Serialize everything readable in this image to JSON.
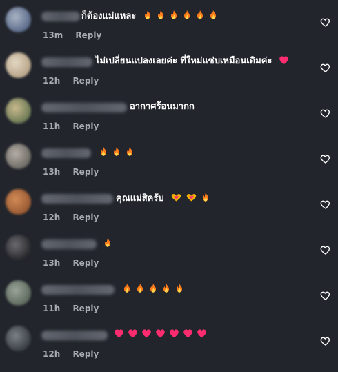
{
  "comments": [
    {
      "text": "ก็ต้องแม่แหละ",
      "emojis": [
        "flame",
        "flame",
        "flame",
        "flame",
        "flame",
        "flame"
      ],
      "time": "13m",
      "reply": "Reply",
      "avatar_colors": [
        "#5b6b8a",
        "#a9b3c4"
      ]
    },
    {
      "text": "ไม่เปลี่ยนแปลงเลยค่ะ ที่ใหม่แซ่บเหมือนเดิมค่ะ",
      "emojis": [
        "heart"
      ],
      "time": "12h",
      "reply": "Reply",
      "avatar_colors": [
        "#b8a58a",
        "#e3d7c2"
      ]
    },
    {
      "text": "อากาศร้อนมากก",
      "emojis": [],
      "time": "11h",
      "reply": "Reply",
      "avatar_colors": [
        "#6c7a55",
        "#c9b98e"
      ]
    },
    {
      "text": "",
      "emojis": [
        "flame",
        "flame",
        "flame"
      ],
      "time": "13h",
      "reply": "Reply",
      "avatar_colors": [
        "#6e6a64",
        "#b4aea6"
      ]
    },
    {
      "text": "คุณแม่สิครับ",
      "emojis": [
        "heart-hands",
        "heart-hands",
        "flame"
      ],
      "time": "12h",
      "reply": "Reply",
      "avatar_colors": [
        "#9a5a33",
        "#d08a55"
      ]
    },
    {
      "text": "",
      "emojis": [
        "flame"
      ],
      "time": "13h",
      "reply": "Reply",
      "avatar_colors": [
        "#2a2a2e",
        "#6a6a70"
      ]
    },
    {
      "text": "",
      "emojis": [
        "flame",
        "flame",
        "flame",
        "flame",
        "flame"
      ],
      "time": "11h",
      "reply": "Reply",
      "avatar_colors": [
        "#5e6a5e",
        "#9aa598"
      ]
    },
    {
      "text": "",
      "emojis": [
        "heart",
        "heart",
        "heart",
        "heart",
        "heart",
        "heart",
        "heart"
      ],
      "time": "12h",
      "reply": "Reply",
      "avatar_colors": [
        "#3a3f44",
        "#7b8087"
      ]
    }
  ],
  "icons": {
    "like": "heart-outline-icon"
  },
  "colors": {
    "background": "#22252c",
    "meta_text": "#a8abb2",
    "flame_outer": "#ff7a1a",
    "flame_inner": "#ffd24a",
    "heart": "#ff2d6f"
  }
}
